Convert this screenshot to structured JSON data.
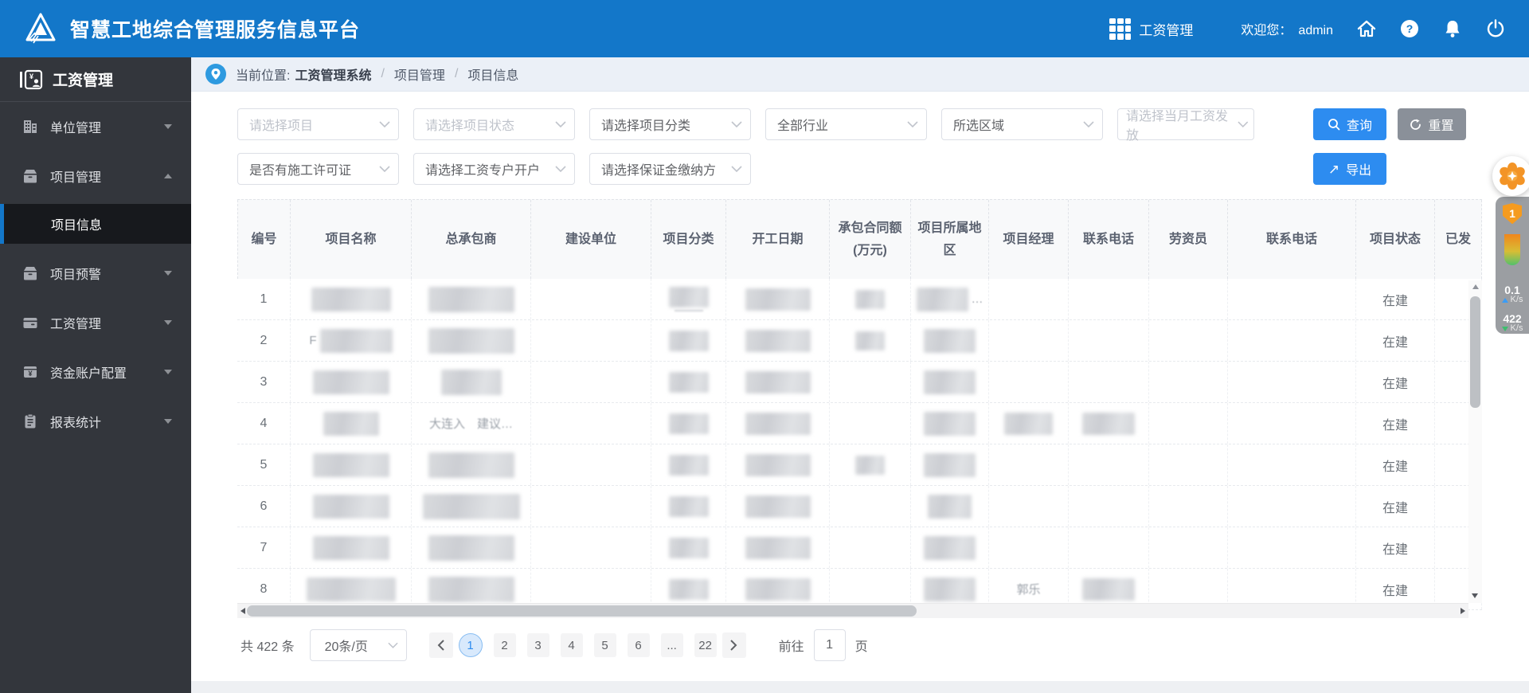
{
  "header": {
    "title": "智慧工地综合管理服务信息平台",
    "app_switcher": "工资管理",
    "welcome": "欢迎您：",
    "username": "admin"
  },
  "sidebar": {
    "title": "工资管理",
    "items": [
      {
        "label": "单位管理"
      },
      {
        "label": "项目管理",
        "children": [
          {
            "label": "项目信息",
            "active": true
          }
        ]
      },
      {
        "label": "项目预警"
      },
      {
        "label": "工资管理"
      },
      {
        "label": "资金账户配置"
      },
      {
        "label": "报表统计"
      }
    ]
  },
  "breadcrumb": {
    "prefix": "当前位置:",
    "root": "工资管理系统",
    "items": [
      "项目管理",
      "项目信息"
    ]
  },
  "filters": {
    "row1": [
      {
        "text": "请选择项目",
        "muted": true
      },
      {
        "text": "请选择项目状态",
        "muted": true
      },
      {
        "text": "请选择项目分类",
        "muted": false
      },
      {
        "text": "全部行业",
        "muted": false
      },
      {
        "text": "所选区域",
        "muted": false
      },
      {
        "text": "请选择当月工资发放",
        "muted": true
      }
    ],
    "row2": [
      {
        "text": "是否有施工许可证",
        "muted": false
      },
      {
        "text": "请选择工资专户开户",
        "muted": false
      },
      {
        "text": "请选择保证金缴纳方",
        "muted": false
      }
    ],
    "search_label": "查询",
    "reset_label": "重置",
    "export_label": "导出"
  },
  "table": {
    "columns": [
      "编号",
      "项目名称",
      "总承包商",
      "建设单位",
      "项目分类",
      "开工日期",
      "承包合同额(万元)",
      "项目所属地区",
      "项目经理",
      "联系电话",
      "劳资员",
      "联系电话",
      "项目状态",
      "已发"
    ],
    "rows": [
      {
        "no": "1",
        "status": "在建",
        "cells": {
          "1": {
            "blur": [
              100
            ]
          },
          "2": {
            "blur": [
              108
            ]
          },
          "4": {
            "blur": [
              50
            ],
            "underline": true
          },
          "5": {
            "blur": [
              82
            ]
          },
          "6": {
            "blur": [
              37
            ]
          },
          "7": {
            "blur": [
              65
            ],
            "suffix": "…"
          }
        }
      },
      {
        "no": "2",
        "status": "在建",
        "cells": {
          "1": {
            "blur": [
              91
            ],
            "prefix": "F"
          },
          "2": {
            "blur": [
              108
            ]
          },
          "4": {
            "blur": [
              50
            ]
          },
          "5": {
            "blur": [
              82
            ]
          },
          "6": {
            "blur": [
              37
            ]
          },
          "7": {
            "blur": [
              65
            ]
          }
        }
      },
      {
        "no": "3",
        "status": "在建",
        "cells": {
          "1": {
            "blur": [
              96
            ]
          },
          "2": {
            "blur": [
              76
            ]
          },
          "4": {
            "blur": [
              50
            ]
          },
          "5": {
            "blur": [
              82
            ]
          },
          "7": {
            "blur": [
              65
            ]
          }
        }
      },
      {
        "no": "4",
        "status": "在建",
        "cells": {
          "1": {
            "blur": [
              70
            ]
          },
          "2": {
            "text": "大连入　建议…"
          },
          "4": {
            "blur": [
              50
            ]
          },
          "5": {
            "blur": [
              82
            ]
          },
          "7": {
            "blur": [
              65
            ]
          },
          "8": {
            "blur": [
              61
            ]
          },
          "9": {
            "blur": [
              66
            ]
          }
        }
      },
      {
        "no": "5",
        "status": "在建",
        "cells": {
          "1": {
            "blur": [
              96
            ]
          },
          "2": {
            "blur": [
              108
            ]
          },
          "4": {
            "blur": [
              50
            ]
          },
          "5": {
            "blur": [
              82
            ]
          },
          "6": {
            "blur": [
              37
            ]
          },
          "7": {
            "blur": [
              65
            ]
          }
        }
      },
      {
        "no": "6",
        "status": "在建",
        "cells": {
          "1": {
            "blur": [
              96
            ]
          },
          "2": {
            "blur": [
              122
            ]
          },
          "4": {
            "blur": [
              50
            ]
          },
          "5": {
            "blur": [
              82
            ]
          },
          "7": {
            "blur": [
              55
            ]
          }
        }
      },
      {
        "no": "7",
        "status": "在建",
        "cells": {
          "1": {
            "blur": [
              96
            ]
          },
          "2": {
            "blur": [
              108
            ]
          },
          "4": {
            "blur": [
              50
            ]
          },
          "5": {
            "blur": [
              82
            ]
          },
          "7": {
            "blur": [
              65
            ]
          }
        }
      },
      {
        "no": "8",
        "status": "在建",
        "cells": {
          "1": {
            "blur": [
              112
            ]
          },
          "2": {
            "blur": [
              108
            ]
          },
          "4": {
            "blur": [
              50
            ]
          },
          "5": {
            "blur": [
              82
            ]
          },
          "7": {
            "blur": [
              65
            ]
          },
          "8": {
            "text": "郭乐"
          },
          "9": {
            "blur": [
              66
            ]
          }
        }
      }
    ]
  },
  "pagination": {
    "total_text": "共 422 条",
    "page_size": "20条/页",
    "pages": [
      "1",
      "2",
      "3",
      "4",
      "5",
      "6",
      "...",
      "22"
    ],
    "active_page": "1",
    "goto_label": "前往",
    "goto_value": "1",
    "page_suffix": "页"
  },
  "overlay": {
    "badge": "1",
    "upload_speed": "0.1",
    "upload_unit": "K/s",
    "download_speed": "422",
    "download_unit": "K/s"
  },
  "colors": {
    "header_blue": "#1377c9",
    "accent_blue": "#2d8cf0",
    "reset_gray": "#8a9099",
    "sidebar_bg": "#33363c",
    "active_item_bg": "#17191d",
    "status_text": "#606266"
  }
}
